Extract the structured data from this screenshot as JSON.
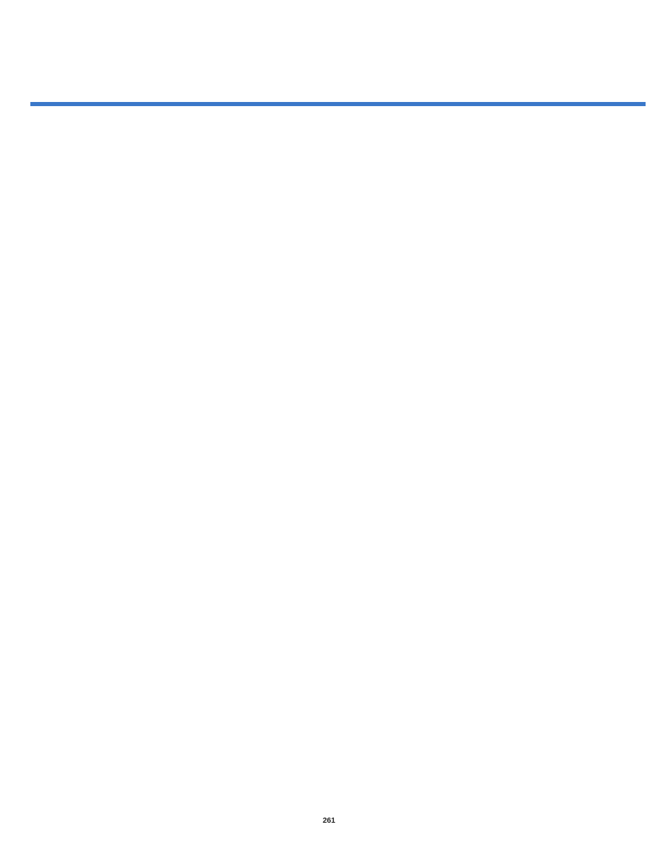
{
  "page_number": "261"
}
